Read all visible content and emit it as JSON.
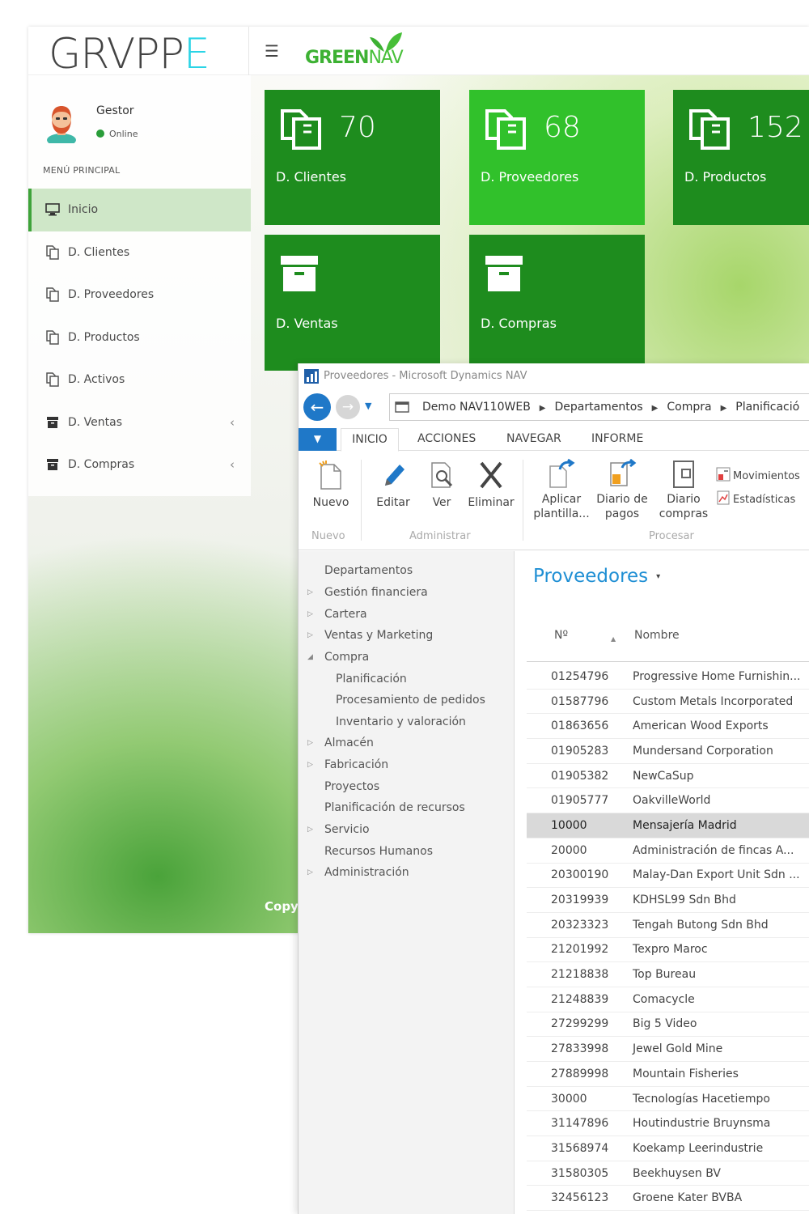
{
  "dashboard": {
    "logo_text": "GRVPP",
    "logo_accent": "E",
    "menu_icon": "hamburger-icon",
    "brand": {
      "text": "GREEN",
      "accent": "NAV"
    },
    "user": {
      "name": "Gestor",
      "status": "Online"
    },
    "menu_heading": "MENÚ PRINCIPAL",
    "menu": [
      {
        "label": "Inicio",
        "icon": "monitor-icon",
        "active": true
      },
      {
        "label": "D. Clientes",
        "icon": "copy-icon"
      },
      {
        "label": "D. Proveedores",
        "icon": "copy-icon"
      },
      {
        "label": "D. Productos",
        "icon": "copy-icon"
      },
      {
        "label": "D. Activos",
        "icon": "copy-icon"
      },
      {
        "label": "D. Ventas",
        "icon": "archive-icon",
        "chevron": "‹"
      },
      {
        "label": "D. Compras",
        "icon": "archive-icon",
        "chevron": "‹"
      }
    ],
    "tiles": [
      {
        "count": "70",
        "label": "D. Clientes",
        "icon": "copy-icon"
      },
      {
        "count": "68",
        "label": "D. Proveedores",
        "icon": "copy-icon",
        "highlight": true
      },
      {
        "count": "152",
        "label": "D. Productos",
        "icon": "copy-icon"
      },
      {
        "label": "D. Ventas",
        "icon": "archive-icon"
      },
      {
        "label": "D. Compras",
        "icon": "archive-icon"
      }
    ],
    "footer_partial": "Copy",
    "colors": {
      "tile": "#1e8c1e",
      "tile_highlight": "#31c12b",
      "accent": "#2ad4e6",
      "active_menu": "#cfe7c8"
    }
  },
  "nav_window": {
    "title": "Proveedores - Microsoft Dynamics NAV",
    "breadcrumbs": [
      "Demo NAV110WEB",
      "Departamentos",
      "Compra",
      "Planificació"
    ],
    "tabs": [
      "INICIO",
      "ACCIONES",
      "NAVEGAR",
      "INFORME"
    ],
    "ribbon": {
      "nuevo": "Nuevo",
      "editar": "Editar",
      "ver": "Ver",
      "eliminar": "Eliminar",
      "aplicar_1": "Aplicar",
      "aplicar_2": "plantilla...",
      "diario_pagos_1": "Diario de",
      "diario_pagos_2": "pagos",
      "diario_compras_1": "Diario",
      "diario_compras_2": "compras",
      "movimientos": "Movimientos",
      "estadisticas": "Estadísticas",
      "groups": {
        "nuevo": "Nuevo",
        "administrar": "Administrar",
        "procesar": "Procesar"
      }
    },
    "nav_pane": [
      {
        "label": "Departamentos"
      },
      {
        "label": "Gestión financiera",
        "arrow": "▷"
      },
      {
        "label": "Cartera",
        "arrow": "▷"
      },
      {
        "label": "Ventas y Marketing",
        "arrow": "▷"
      },
      {
        "label": "Compra",
        "arrow": "◢"
      },
      {
        "label": "Planificación",
        "child": true
      },
      {
        "label": "Procesamiento de pedidos",
        "child": true
      },
      {
        "label": "Inventario y valoración",
        "child": true
      },
      {
        "label": "Almacén",
        "arrow": "▷"
      },
      {
        "label": "Fabricación",
        "arrow": "▷"
      },
      {
        "label": "Proyectos"
      },
      {
        "label": "Planificación de recursos"
      },
      {
        "label": "Servicio",
        "arrow": "▷"
      },
      {
        "label": "Recursos Humanos"
      },
      {
        "label": "Administración",
        "arrow": "▷"
      }
    ],
    "list_title": "Proveedores",
    "list_title_caret": "▾",
    "columns": {
      "no": "Nº",
      "name": "Nombre"
    },
    "rows": [
      {
        "no": "01254796",
        "name": "Progressive Home Furnishin..."
      },
      {
        "no": "01587796",
        "name": "Custom Metals Incorporated"
      },
      {
        "no": "01863656",
        "name": "American Wood Exports"
      },
      {
        "no": "01905283",
        "name": "Mundersand Corporation"
      },
      {
        "no": "01905382",
        "name": "NewCaSup"
      },
      {
        "no": "01905777",
        "name": "OakvilleWorld"
      },
      {
        "no": "10000",
        "name": "Mensajería Madrid",
        "selected": true
      },
      {
        "no": "20000",
        "name": "Administración de fincas A..."
      },
      {
        "no": "20300190",
        "name": "Malay-Dan Export Unit Sdn ..."
      },
      {
        "no": "20319939",
        "name": "KDHSL99 Sdn Bhd"
      },
      {
        "no": "20323323",
        "name": "Tengah Butong Sdn Bhd"
      },
      {
        "no": "21201992",
        "name": "Texpro Maroc"
      },
      {
        "no": "21218838",
        "name": "Top Bureau"
      },
      {
        "no": "21248839",
        "name": "Comacycle"
      },
      {
        "no": "27299299",
        "name": "Big 5 Video"
      },
      {
        "no": "27833998",
        "name": "Jewel Gold Mine"
      },
      {
        "no": "27889998",
        "name": "Mountain Fisheries"
      },
      {
        "no": "30000",
        "name": "Tecnologías Hacetiempo"
      },
      {
        "no": "31147896",
        "name": "Houtindustrie Bruynsma"
      },
      {
        "no": "31568974",
        "name": "Koekamp Leerindustrie"
      },
      {
        "no": "31580305",
        "name": "Beekhuysen BV"
      },
      {
        "no": "32456123",
        "name": "Groene Kater BVBA"
      }
    ],
    "colors": {
      "title_blue": "#1f8fd4",
      "action_blue": "#1f78c8",
      "selected_row": "#d9d9d9"
    }
  }
}
